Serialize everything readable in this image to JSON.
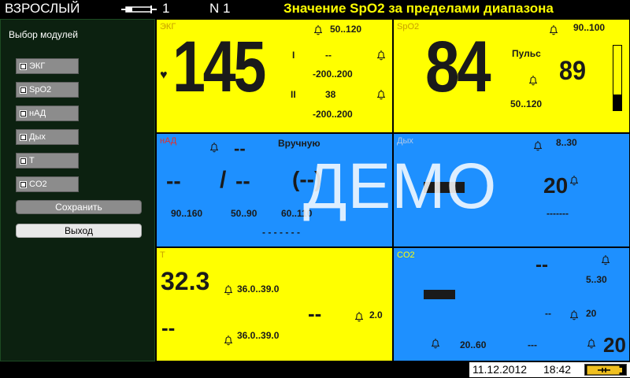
{
  "header": {
    "mode": "ВЗРОСЛЫЙ",
    "patient_no": "1",
    "bed": "N 1",
    "alarm_message": "Значение SpO2 за пределами диапазона"
  },
  "sidebar": {
    "title": "Выбор модулей",
    "modules": [
      "ЭКГ",
      "SpO2",
      "нАД",
      "Дых",
      "Т",
      "CO2"
    ],
    "save_label": "Сохранить",
    "exit_label": "Выход"
  },
  "ecg": {
    "label": "ЭКГ",
    "hr": "145",
    "hr_limits": "50..120",
    "lead1": "I",
    "lead1_val": "--",
    "lead1_limits": "-200..200",
    "lead2": "II",
    "lead2_val": "38",
    "lead2_limits": "-200..200"
  },
  "spo2": {
    "label": "SpO2",
    "value": "84",
    "limits": "90..100",
    "pulse_label": "Пульс",
    "pulse_value": "89",
    "pulse_limits": "50..120",
    "bar_level": 0.25
  },
  "nibp": {
    "label": "нАД",
    "mode": "Вручную",
    "top_value": "--",
    "sys": "--",
    "slash": "/",
    "dia": "--",
    "mean": "(--)",
    "sys_limits": "90..160",
    "dia_limits": "50..90",
    "mean_limits": "60..110",
    "time": "- - - - - - -"
  },
  "resp": {
    "label": "Дых",
    "limits": "8..30",
    "value": "20",
    "dashes": "-------"
  },
  "temp": {
    "label": "Т",
    "t1": "32.3",
    "t1_limits": "36.0..39.0",
    "t2": "--",
    "t2_limits": "36.0..39.0",
    "delta": "--",
    "delta_limit": "2.0"
  },
  "co2": {
    "label": "CO2",
    "etco2": "--",
    "etco2_limits": "5..30",
    "fi_val": "--",
    "fi_limit": "20",
    "awrr": "---",
    "awrr_limits": "20..60",
    "rr": "20"
  },
  "demo_text": "ДЕМО",
  "footer": {
    "date": "11.12.2012",
    "time": "18:42"
  },
  "colors": {
    "yellow_panel": "#ffff00",
    "blue_panel": "#1e90ff",
    "alarm_text": "#ffff00",
    "sidebar_bg": "#0c2110"
  }
}
